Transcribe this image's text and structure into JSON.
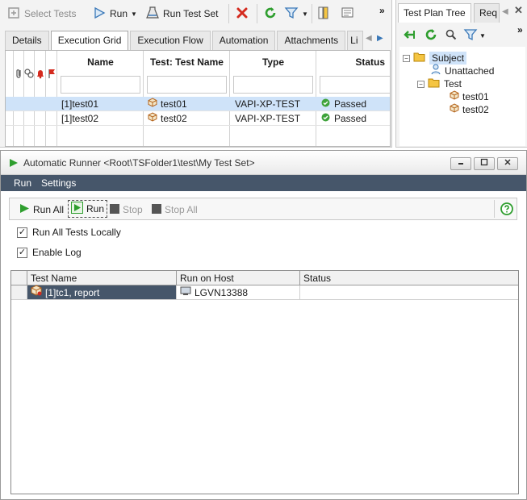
{
  "toolbar": {
    "select_tests": "Select Tests",
    "run": "Run",
    "run_test_set": "Run Test Set",
    "overflow": "»"
  },
  "tabs": [
    "Details",
    "Execution Grid",
    "Execution Flow",
    "Automation",
    "Attachments",
    "Li"
  ],
  "grid": {
    "columns": [
      "Name",
      "Test: Test Name",
      "Type",
      "Status"
    ],
    "rows": [
      {
        "name": "[1]test01",
        "test_name": "test01",
        "type": "VAPI-XP-TEST",
        "status": "Passed"
      },
      {
        "name": "[1]test02",
        "test_name": "test02",
        "type": "VAPI-XP-TEST",
        "status": "Passed"
      }
    ]
  },
  "right_panel": {
    "tabs": [
      "Test Plan Tree",
      "Req"
    ],
    "overflow": "»",
    "tree": {
      "root": "Subject",
      "unattached": "Unattached",
      "folder": "Test",
      "tests": [
        "test01",
        "test02"
      ]
    }
  },
  "runner": {
    "title": "Automatic Runner <Root\\TSFolder1\\test\\My Test Set>",
    "menu": [
      "Run",
      "Settings"
    ],
    "toolbar": {
      "run_all": "Run All",
      "run": "Run",
      "stop": "Stop",
      "stop_all": "Stop All"
    },
    "run_all_locally": "Run All Tests Locally",
    "enable_log": "Enable Log",
    "grid_columns": [
      "Test Name",
      "Run on Host",
      "Status"
    ],
    "rows": [
      {
        "test_name": "[1]tc1, report",
        "host": "LGVN13388",
        "status": ""
      }
    ]
  },
  "colors": {
    "accent": "#46566a",
    "passed": "#3fa33b",
    "run_green": "#2e9e2e",
    "selection": "#cfe3f9",
    "delete_red": "#d42a1e"
  }
}
